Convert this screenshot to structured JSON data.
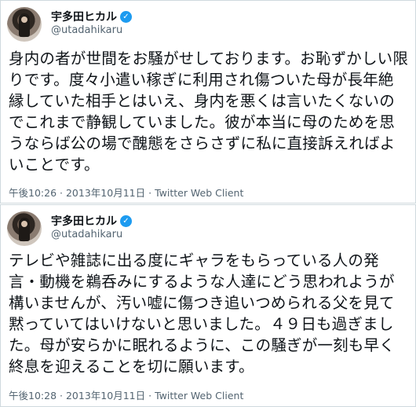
{
  "tweets": [
    {
      "display_name": "宇多田ヒカル",
      "handle": "@utadahikaru",
      "text": "身内の者が世間をお騒がせしております。お恥ずかしい限りです。度々小遣い稼ぎに利用され傷ついた母が長年絶縁していた相手とはいえ、身内を悪くは言いたくないのでこれまで静観していました。彼が本当に母のためを思うならば公の場で醜態をさらさずに私に直接訴えればよいことです。",
      "time": "午後10:26",
      "date": "2013年10月11日",
      "separator": "·",
      "client": "Twitter Web Client"
    },
    {
      "display_name": "宇多田ヒカル",
      "handle": "@utadahikaru",
      "text": "テレビや雑誌に出る度にギャラをもらっている人の発言・動機を鵜呑みにするような人達にどう思われようが構いませんが、汚い嘘に傷つき追いつめられる父を見て黙っていてはいけないと思いました。４９日も過ぎました。母が安らかに眠れるように、この騒ぎが一刻も早く終息を迎えることを切に願います。",
      "time": "午後10:28",
      "date": "2013年10月11日",
      "separator": "·",
      "client": "Twitter Web Client"
    }
  ],
  "colors": {
    "verified": "#1d9bf0",
    "secondary_text": "#536471",
    "border": "#cfd9de"
  },
  "icons": {
    "verified": "verified-badge-icon"
  }
}
